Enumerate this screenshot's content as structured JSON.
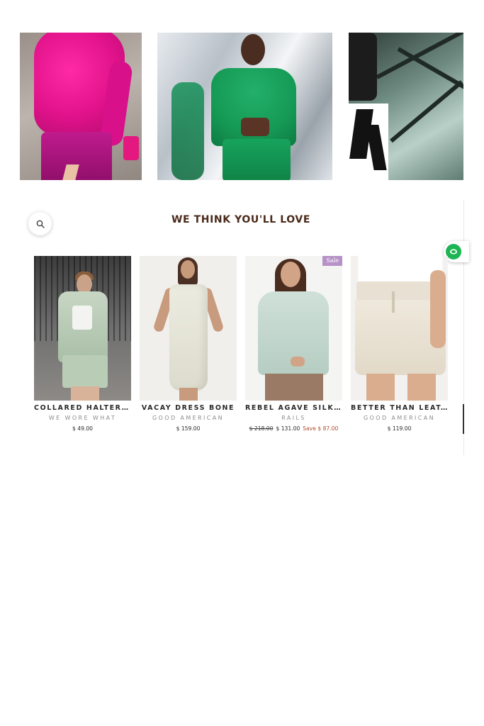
{
  "gallery": {
    "images": [
      {
        "alt": "Model in pink sweater and shorts"
      },
      {
        "alt": "Model in green jacket and skirt"
      },
      {
        "alt": "Model in black and white outfit"
      }
    ]
  },
  "section": {
    "title": "WE THINK YOU'LL LOVE"
  },
  "products": [
    {
      "name": "COLLARED HALTER ...",
      "brand": "WE WORE WHAT",
      "price": "$ 49.00",
      "old_price": "",
      "save": "",
      "badge": ""
    },
    {
      "name": "VACAY DRESS BONE",
      "brand": "GOOD AMERICAN",
      "price": "$ 159.00",
      "old_price": "",
      "save": "",
      "badge": ""
    },
    {
      "name": "REBEL AGAVE SILK...",
      "brand": "RAILS",
      "price": "$ 131.00",
      "old_price": "$ 218.00",
      "save": "Save $ 87.00",
      "badge": "Sale"
    },
    {
      "name": "BETTER THAN LEAT...",
      "brand": "GOOD AMERICAN",
      "price": "$ 119.00",
      "old_price": "",
      "save": "",
      "badge": ""
    }
  ],
  "colors": {
    "title": "#4a2a1a",
    "sale_badge": "#b792c7",
    "save_text": "#b04a2e",
    "chat": "#1db554"
  },
  "icons": {
    "search": "search-icon",
    "chat": "chat-icon"
  }
}
